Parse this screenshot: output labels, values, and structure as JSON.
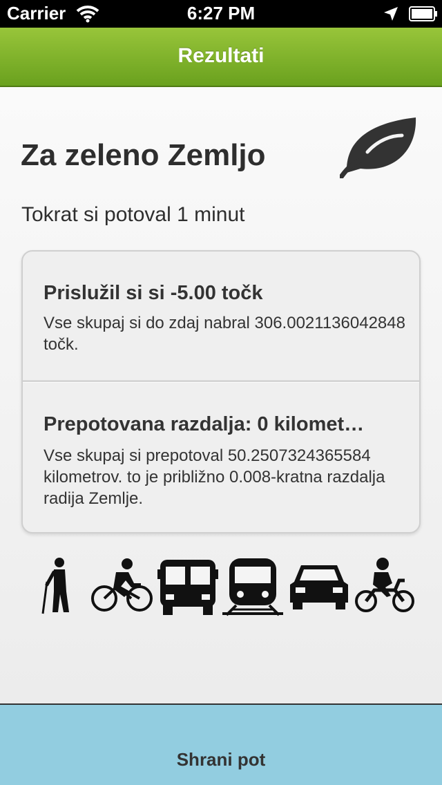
{
  "status_bar": {
    "carrier": "Carrier",
    "time": "6:27 PM"
  },
  "nav": {
    "title": "Rezultati"
  },
  "main": {
    "title": "Za zeleno Zemljo",
    "travel_time": "Tokrat si potoval 1 minut",
    "points": {
      "heading": "Prislužil si si -5.00 točk",
      "body": "Vse skupaj si do zdaj nabral 306.0021136042848 točk."
    },
    "distance": {
      "heading": "Prepotovana razdalja: 0 kilomet…",
      "body": "Vse skupaj si prepotoval 50.2507324365584 kilometrov. to je približno 0.008-kratna razdalja radija Zemlje."
    },
    "transport_modes": [
      "walk-icon",
      "bicycle-icon",
      "bus-icon",
      "train-icon",
      "car-icon",
      "motorcycle-icon"
    ]
  },
  "footer": {
    "save_label": "Shrani pot"
  },
  "colors": {
    "nav_green": "#7db52a",
    "save_blue": "#92cde0",
    "text": "#2e2e2e"
  }
}
